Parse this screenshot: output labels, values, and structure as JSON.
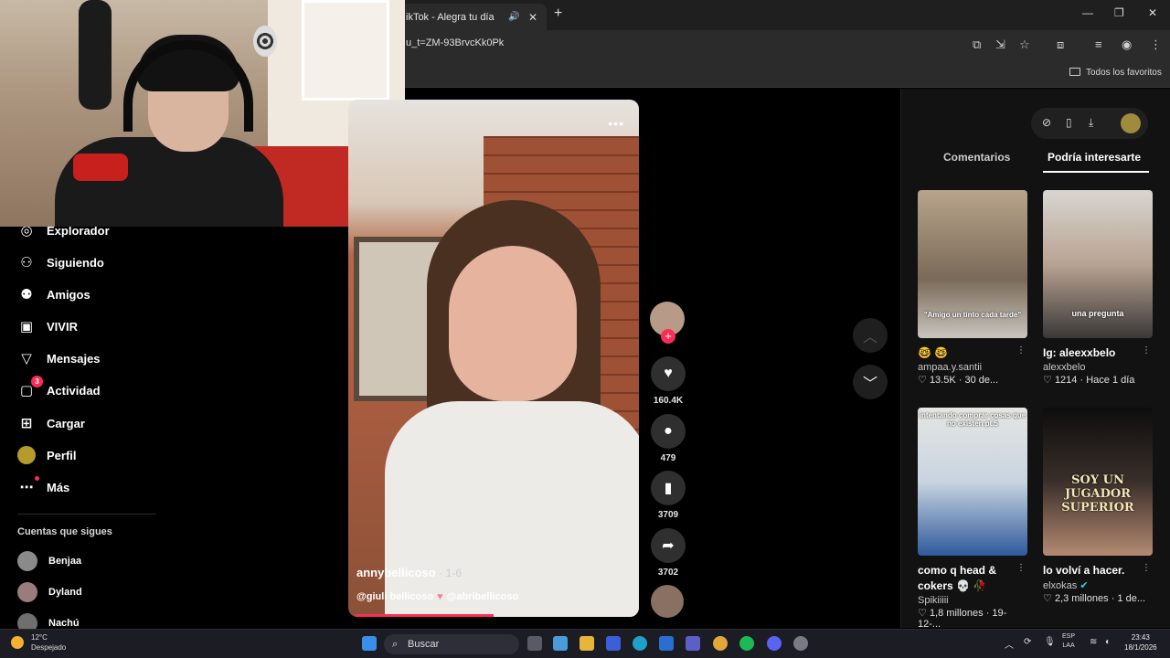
{
  "browser": {
    "tab_title": "ikTok - Alegra tu día",
    "url_partial": "u_t=ZM-93BrvcKk0Pk",
    "favorites_label": "Todos los favoritos"
  },
  "sidebar": {
    "items": [
      {
        "label": "Explorador",
        "icon": "compass-icon"
      },
      {
        "label": "Siguiendo",
        "icon": "user-follow-icon"
      },
      {
        "label": "Amigos",
        "icon": "friends-icon"
      },
      {
        "label": "VIVIR",
        "icon": "live-tv-icon"
      },
      {
        "label": "Mensajes",
        "icon": "send-icon"
      },
      {
        "label": "Actividad",
        "icon": "inbox-icon",
        "badge": "3"
      },
      {
        "label": "Cargar",
        "icon": "upload-plus-icon"
      },
      {
        "label": "Perfil",
        "icon": "profile-avatar-icon"
      },
      {
        "label": "Más",
        "icon": "more-dots-icon"
      }
    ],
    "following_title": "Cuentas que sigues",
    "following": [
      "Benjaa",
      "Dyland",
      "Nachú"
    ]
  },
  "video": {
    "author": "annybellicoso",
    "date": "· 1-6",
    "mention1": "@giuli bellicoso",
    "mention2": "@abribellicoso",
    "progress": 0.5
  },
  "actions": {
    "likes": "160.4K",
    "comments": "479",
    "saves": "3709",
    "shares": "3702"
  },
  "right_panel": {
    "tab_comments": "Comentarios",
    "tab_suggested": "Podría interesarte",
    "cards": [
      {
        "title": "🤓 🤓",
        "user": "ampaa.y.santii",
        "likes": "13.5K",
        "date": "· 30 de...",
        "caption": "\"Amigo un tinto cada tarde\""
      },
      {
        "title": "Ig: aleexxbelo",
        "user": "alexxbelo",
        "likes": "1214",
        "date": "· Hace 1 día",
        "caption": "una pregunta"
      },
      {
        "title": "como q head & cokers 💀 🥀",
        "user": "Spikiiiii",
        "likes": "1,8 millones",
        "date": "· 19-12-...",
        "caption": "intentando comprar cosas que no existen pt.5"
      },
      {
        "title": "lo volví a hacer.",
        "user": "elxokas",
        "likes": "2,3 millones",
        "date": "· 1 de...",
        "caption": "SOY UN JUGADOR SUPERIOR"
      }
    ]
  },
  "taskbar": {
    "temperature": "12°C",
    "weather": "Despejado",
    "search": "Buscar",
    "lang1": "ESP",
    "lang2": "LAA",
    "time": "23:43",
    "date": "18/1/2026"
  }
}
